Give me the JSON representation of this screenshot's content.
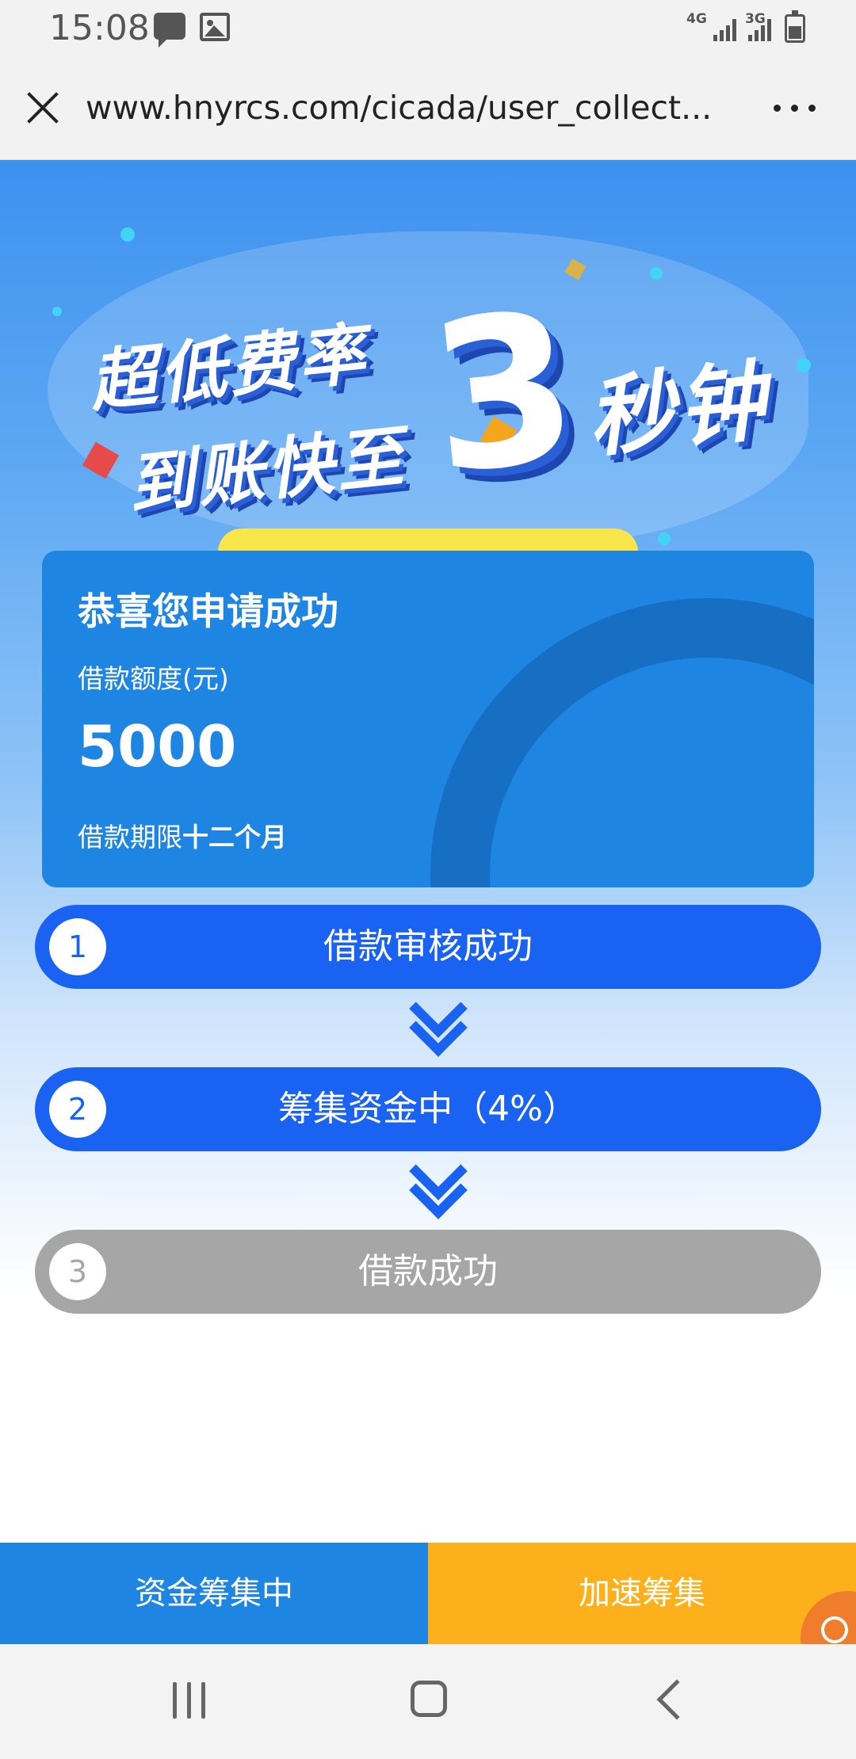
{
  "status_bar": {
    "time": "15:08",
    "network_1": "4G",
    "network_2": "3G"
  },
  "url_bar": {
    "url": "www.hnyrcs.com/cicada/user_collect..."
  },
  "banner": {
    "line1": "超低费率",
    "line2": "到账快至",
    "big_number": "3",
    "line3": "秒钟"
  },
  "card": {
    "title": "恭喜您申请成功",
    "amount_label": "借款额度(元)",
    "amount": "5000",
    "term_prefix": "借款期限",
    "term_value": "十二个月"
  },
  "steps": [
    {
      "number": "1",
      "label": "借款审核成功",
      "status": "active"
    },
    {
      "number": "2",
      "label": "筹集资金中（4%）",
      "status": "active"
    },
    {
      "number": "3",
      "label": "借款成功",
      "status": "inactive"
    }
  ],
  "bottom_bar": {
    "left_label": "资金筹集中",
    "right_label": "加速筹集"
  },
  "colors": {
    "primary_blue": "#1a63f2",
    "card_blue": "#1e85e2",
    "accent_orange": "#fbb01c",
    "inactive_gray": "#a6a6a6"
  },
  "icons": [
    "message-icon",
    "image-icon",
    "signal-icon",
    "battery-icon",
    "close-icon",
    "more-icon",
    "chevron-down-icon",
    "share-icon",
    "nav-recent-icon",
    "nav-home-icon",
    "nav-back-icon"
  ]
}
